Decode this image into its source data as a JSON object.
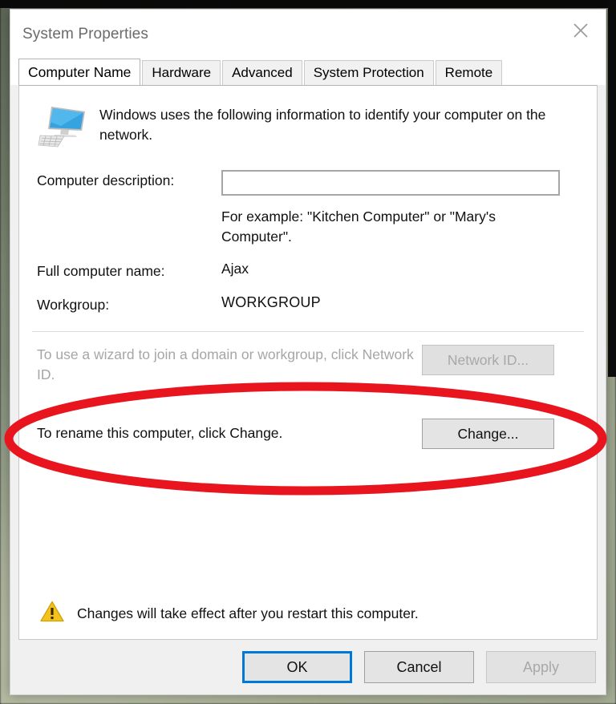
{
  "window": {
    "title": "System Properties",
    "close_icon": "close-icon"
  },
  "tabs": [
    {
      "label": "Computer Name",
      "active": true
    },
    {
      "label": "Hardware",
      "active": false
    },
    {
      "label": "Advanced",
      "active": false
    },
    {
      "label": "System Protection",
      "active": false
    },
    {
      "label": "Remote",
      "active": false
    }
  ],
  "content": {
    "intro_icon": "computer-monitor-icon",
    "intro_text": "Windows uses the following information to identify your computer on the network.",
    "description_label": "Computer description:",
    "description_value": "",
    "description_placeholder": "",
    "description_hint": "For example: \"Kitchen Computer\" or \"Mary's Computer\".",
    "full_name_label": "Full computer name:",
    "full_name_value": "Ajax",
    "workgroup_label": "Workgroup:",
    "workgroup_value": "WORKGROUP",
    "network_id_text": "To use a wizard to join a domain or workgroup, click Network ID.",
    "network_id_button": "Network ID...",
    "network_id_disabled": true,
    "rename_text": "To rename this computer, click Change.",
    "change_button": "Change...",
    "warning_icon": "warning-triangle-icon",
    "warning_text": "Changes will take effect after you restart this computer."
  },
  "footer": {
    "ok_label": "OK",
    "cancel_label": "Cancel",
    "apply_label": "Apply",
    "apply_disabled": true,
    "focus_color": "#0078d7"
  },
  "annotation": {
    "shape": "ellipse",
    "color": "#e8141e",
    "target": "rename-row"
  }
}
